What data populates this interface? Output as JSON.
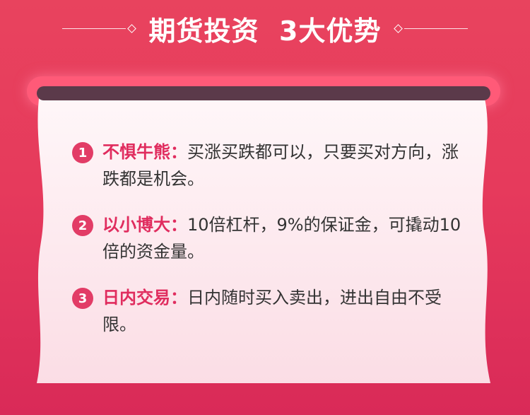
{
  "header": {
    "title": "期货投资  3大优势"
  },
  "advantages": [
    {
      "number": "1",
      "label": "不惧牛熊：",
      "text": "买涨买跌都可以，只要买对方向，涨跌都是机会。"
    },
    {
      "number": "2",
      "label": "以小博大：",
      "text": "10倍杠杆，9%的保证金，可撬动10倍的资金量。"
    },
    {
      "number": "3",
      "label": "日内交易：",
      "text": "日内随时买入卖出，进出自由不受限。"
    }
  ],
  "colors": {
    "background": "#e63a5c",
    "accent": "#e23c66",
    "label": "#e02c5e",
    "paper": "#fdeef2",
    "roller": "#5b3a4a"
  }
}
